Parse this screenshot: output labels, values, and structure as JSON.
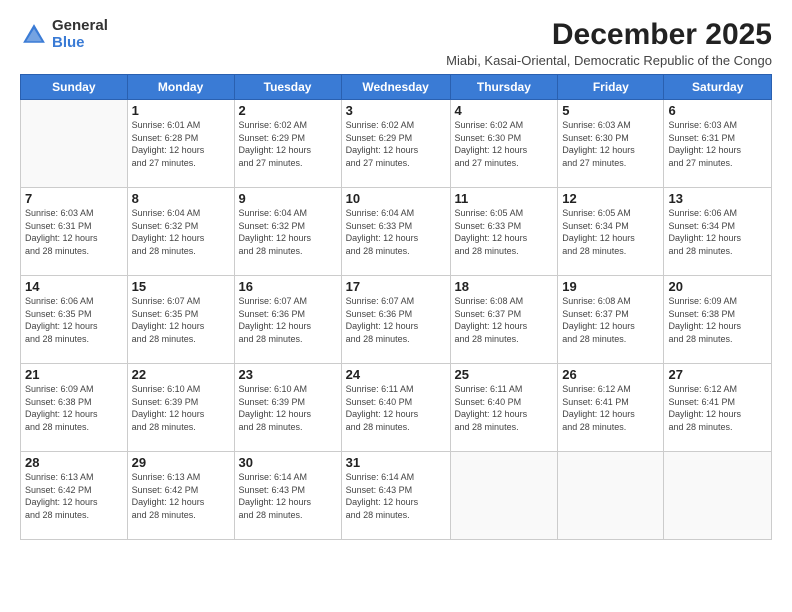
{
  "logo": {
    "general": "General",
    "blue": "Blue"
  },
  "calendar": {
    "title": "December 2025",
    "subtitle": "Miabi, Kasai-Oriental, Democratic Republic of the Congo",
    "headers": [
      "Sunday",
      "Monday",
      "Tuesday",
      "Wednesday",
      "Thursday",
      "Friday",
      "Saturday"
    ],
    "weeks": [
      [
        {
          "day": "",
          "info": ""
        },
        {
          "day": "1",
          "info": "Sunrise: 6:01 AM\nSunset: 6:28 PM\nDaylight: 12 hours\nand 27 minutes."
        },
        {
          "day": "2",
          "info": "Sunrise: 6:02 AM\nSunset: 6:29 PM\nDaylight: 12 hours\nand 27 minutes."
        },
        {
          "day": "3",
          "info": "Sunrise: 6:02 AM\nSunset: 6:29 PM\nDaylight: 12 hours\nand 27 minutes."
        },
        {
          "day": "4",
          "info": "Sunrise: 6:02 AM\nSunset: 6:30 PM\nDaylight: 12 hours\nand 27 minutes."
        },
        {
          "day": "5",
          "info": "Sunrise: 6:03 AM\nSunset: 6:30 PM\nDaylight: 12 hours\nand 27 minutes."
        },
        {
          "day": "6",
          "info": "Sunrise: 6:03 AM\nSunset: 6:31 PM\nDaylight: 12 hours\nand 27 minutes."
        }
      ],
      [
        {
          "day": "7",
          "info": "Sunrise: 6:03 AM\nSunset: 6:31 PM\nDaylight: 12 hours\nand 28 minutes."
        },
        {
          "day": "8",
          "info": "Sunrise: 6:04 AM\nSunset: 6:32 PM\nDaylight: 12 hours\nand 28 minutes."
        },
        {
          "day": "9",
          "info": "Sunrise: 6:04 AM\nSunset: 6:32 PM\nDaylight: 12 hours\nand 28 minutes."
        },
        {
          "day": "10",
          "info": "Sunrise: 6:04 AM\nSunset: 6:33 PM\nDaylight: 12 hours\nand 28 minutes."
        },
        {
          "day": "11",
          "info": "Sunrise: 6:05 AM\nSunset: 6:33 PM\nDaylight: 12 hours\nand 28 minutes."
        },
        {
          "day": "12",
          "info": "Sunrise: 6:05 AM\nSunset: 6:34 PM\nDaylight: 12 hours\nand 28 minutes."
        },
        {
          "day": "13",
          "info": "Sunrise: 6:06 AM\nSunset: 6:34 PM\nDaylight: 12 hours\nand 28 minutes."
        }
      ],
      [
        {
          "day": "14",
          "info": "Sunrise: 6:06 AM\nSunset: 6:35 PM\nDaylight: 12 hours\nand 28 minutes."
        },
        {
          "day": "15",
          "info": "Sunrise: 6:07 AM\nSunset: 6:35 PM\nDaylight: 12 hours\nand 28 minutes."
        },
        {
          "day": "16",
          "info": "Sunrise: 6:07 AM\nSunset: 6:36 PM\nDaylight: 12 hours\nand 28 minutes."
        },
        {
          "day": "17",
          "info": "Sunrise: 6:07 AM\nSunset: 6:36 PM\nDaylight: 12 hours\nand 28 minutes."
        },
        {
          "day": "18",
          "info": "Sunrise: 6:08 AM\nSunset: 6:37 PM\nDaylight: 12 hours\nand 28 minutes."
        },
        {
          "day": "19",
          "info": "Sunrise: 6:08 AM\nSunset: 6:37 PM\nDaylight: 12 hours\nand 28 minutes."
        },
        {
          "day": "20",
          "info": "Sunrise: 6:09 AM\nSunset: 6:38 PM\nDaylight: 12 hours\nand 28 minutes."
        }
      ],
      [
        {
          "day": "21",
          "info": "Sunrise: 6:09 AM\nSunset: 6:38 PM\nDaylight: 12 hours\nand 28 minutes."
        },
        {
          "day": "22",
          "info": "Sunrise: 6:10 AM\nSunset: 6:39 PM\nDaylight: 12 hours\nand 28 minutes."
        },
        {
          "day": "23",
          "info": "Sunrise: 6:10 AM\nSunset: 6:39 PM\nDaylight: 12 hours\nand 28 minutes."
        },
        {
          "day": "24",
          "info": "Sunrise: 6:11 AM\nSunset: 6:40 PM\nDaylight: 12 hours\nand 28 minutes."
        },
        {
          "day": "25",
          "info": "Sunrise: 6:11 AM\nSunset: 6:40 PM\nDaylight: 12 hours\nand 28 minutes."
        },
        {
          "day": "26",
          "info": "Sunrise: 6:12 AM\nSunset: 6:41 PM\nDaylight: 12 hours\nand 28 minutes."
        },
        {
          "day": "27",
          "info": "Sunrise: 6:12 AM\nSunset: 6:41 PM\nDaylight: 12 hours\nand 28 minutes."
        }
      ],
      [
        {
          "day": "28",
          "info": "Sunrise: 6:13 AM\nSunset: 6:42 PM\nDaylight: 12 hours\nand 28 minutes."
        },
        {
          "day": "29",
          "info": "Sunrise: 6:13 AM\nSunset: 6:42 PM\nDaylight: 12 hours\nand 28 minutes."
        },
        {
          "day": "30",
          "info": "Sunrise: 6:14 AM\nSunset: 6:43 PM\nDaylight: 12 hours\nand 28 minutes."
        },
        {
          "day": "31",
          "info": "Sunrise: 6:14 AM\nSunset: 6:43 PM\nDaylight: 12 hours\nand 28 minutes."
        },
        {
          "day": "",
          "info": ""
        },
        {
          "day": "",
          "info": ""
        },
        {
          "day": "",
          "info": ""
        }
      ]
    ]
  }
}
